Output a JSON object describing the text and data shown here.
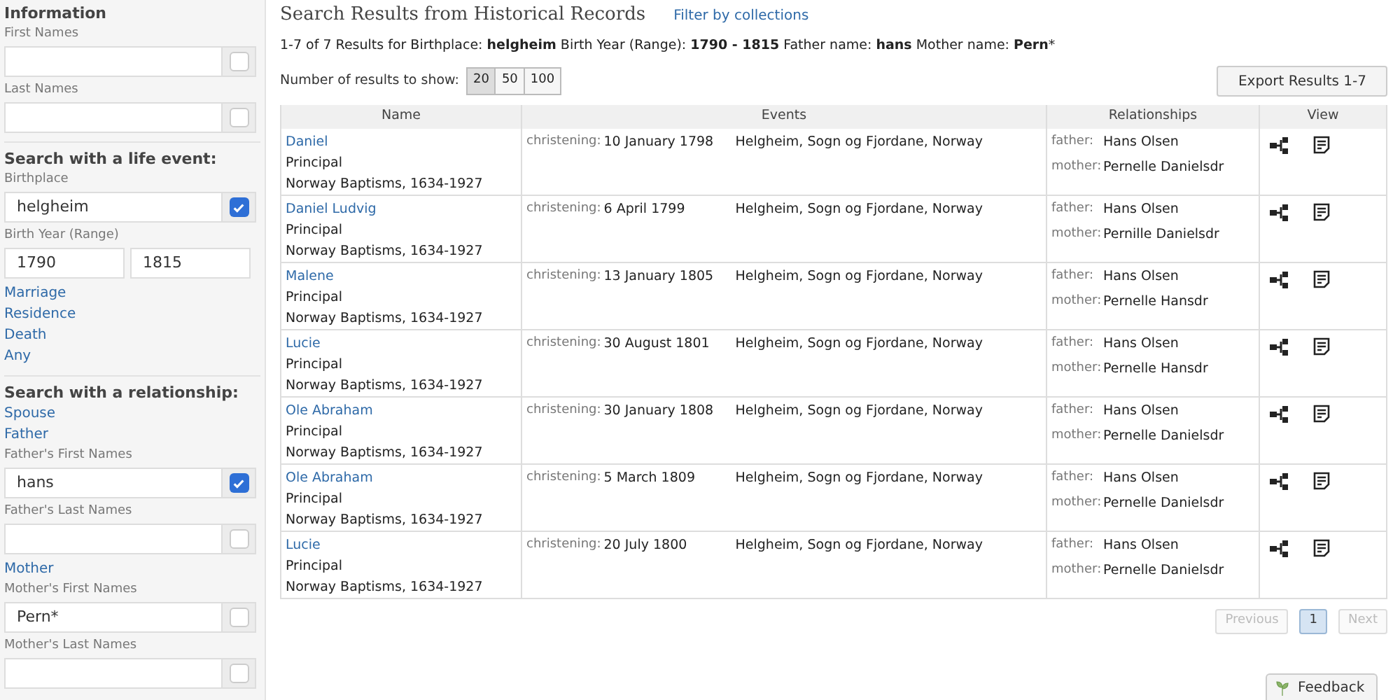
{
  "sidebar": {
    "sections": [
      {
        "heading": "Information",
        "items": [
          {
            "kind": "label",
            "text": "First Names"
          },
          {
            "kind": "field",
            "value": "",
            "checked": false
          },
          {
            "kind": "label",
            "text": "Last Names"
          },
          {
            "kind": "field",
            "value": "",
            "checked": false
          }
        ]
      },
      {
        "heading": "Search with a life event:",
        "items": [
          {
            "kind": "label",
            "text": "Birthplace"
          },
          {
            "kind": "field",
            "value": "helgheim",
            "checked": true
          },
          {
            "kind": "label",
            "text": "Birth Year (Range)"
          },
          {
            "kind": "range",
            "from": "1790",
            "to": "1815"
          },
          {
            "kind": "link",
            "text": "Marriage"
          },
          {
            "kind": "link",
            "text": "Residence"
          },
          {
            "kind": "link",
            "text": "Death"
          },
          {
            "kind": "link",
            "text": "Any"
          }
        ]
      },
      {
        "heading": "Search with a relationship:",
        "items": [
          {
            "kind": "link",
            "text": "Spouse"
          },
          {
            "kind": "link",
            "text": "Father"
          },
          {
            "kind": "label",
            "text": "Father's First Names"
          },
          {
            "kind": "field",
            "value": "hans",
            "checked": true
          },
          {
            "kind": "label",
            "text": "Father's Last Names"
          },
          {
            "kind": "field",
            "value": "",
            "checked": false
          },
          {
            "kind": "link",
            "text": "Mother"
          },
          {
            "kind": "label",
            "text": "Mother's First Names"
          },
          {
            "kind": "field",
            "value": "Pern*",
            "checked": false
          },
          {
            "kind": "label",
            "text": "Mother's Last Names"
          },
          {
            "kind": "field",
            "value": "",
            "checked": false
          }
        ]
      }
    ]
  },
  "title": "Search Results from Historical Records",
  "filter_link": "Filter by collections",
  "summary": "1-7 of 7 Results for Birthplace: **helgheim** Birth Year (Range): **1790 - 1815** Father name: **hans** Mother name: **Pern***",
  "results_count": {
    "label": "Number of results to show:",
    "options": [
      {
        "text": "20",
        "selected": true
      },
      {
        "text": "50",
        "selected": false
      },
      {
        "text": "100",
        "selected": false
      }
    ]
  },
  "export_button": "Export Results 1-7",
  "table": {
    "columns": [
      "Name",
      "Events",
      "Relationships",
      "View"
    ],
    "rows": [
      {
        "name": "Daniel",
        "role": "Principal",
        "collection": "Norway Baptisms, 1634-1927",
        "event": "christening:",
        "date": "10 January 1798",
        "place": "Helgheim, Sogn og Fjordane, Norway",
        "father_label": "father:",
        "father": "Hans Olsen",
        "mother_label": "mother:",
        "mother": "Pernelle Danielsdr"
      },
      {
        "name": "Daniel Ludvig",
        "role": "Principal",
        "collection": "Norway Baptisms, 1634-1927",
        "event": "christening:",
        "date": "6 April 1799",
        "place": "Helgheim, Sogn og Fjordane, Norway",
        "father_label": "father:",
        "father": "Hans Olsen",
        "mother_label": "mother:",
        "mother": "Pernille Danielsdr"
      },
      {
        "name": "Malene",
        "role": "Principal",
        "collection": "Norway Baptisms, 1634-1927",
        "event": "christening:",
        "date": "13 January 1805",
        "place": "Helgheim, Sogn og Fjordane, Norway",
        "father_label": "father:",
        "father": "Hans Olsen",
        "mother_label": "mother:",
        "mother": "Pernelle Hansdr"
      },
      {
        "name": "Lucie",
        "role": "Principal",
        "collection": "Norway Baptisms, 1634-1927",
        "event": "christening:",
        "date": "30 August 1801",
        "place": "Helgheim, Sogn og Fjordane, Norway",
        "father_label": "father:",
        "father": "Hans Olsen",
        "mother_label": "mother:",
        "mother": "Pernelle Hansdr"
      },
      {
        "name": "Ole Abraham",
        "role": "Principal",
        "collection": "Norway Baptisms, 1634-1927",
        "event": "christening:",
        "date": "30 January 1808",
        "place": "Helgheim, Sogn og Fjordane, Norway",
        "father_label": "father:",
        "father": "Hans Olsen",
        "mother_label": "mother:",
        "mother": "Pernelle Danielsdr"
      },
      {
        "name": "Ole Abraham",
        "role": "Principal",
        "collection": "Norway Baptisms, 1634-1927",
        "event": "christening:",
        "date": "5 March 1809",
        "place": "Helgheim, Sogn og Fjordane, Norway",
        "father_label": "father:",
        "father": "Hans Olsen",
        "mother_label": "mother:",
        "mother": "Pernelle Danielsdr"
      },
      {
        "name": "Lucie",
        "role": "Principal",
        "collection": "Norway Baptisms, 1634-1927",
        "event": "christening:",
        "date": "20 July 1800",
        "place": "Helgheim, Sogn og Fjordane, Norway",
        "father_label": "father:",
        "father": "Hans Olsen",
        "mother_label": "mother:",
        "mother": "Pernelle Danielsdr"
      }
    ]
  },
  "pagination": {
    "previous": {
      "text": "Previous",
      "disabled": true
    },
    "pages": [
      {
        "text": "1",
        "selected": true
      }
    ],
    "next": {
      "text": "Next",
      "disabled": true
    }
  },
  "feedback_button": "Feedback"
}
